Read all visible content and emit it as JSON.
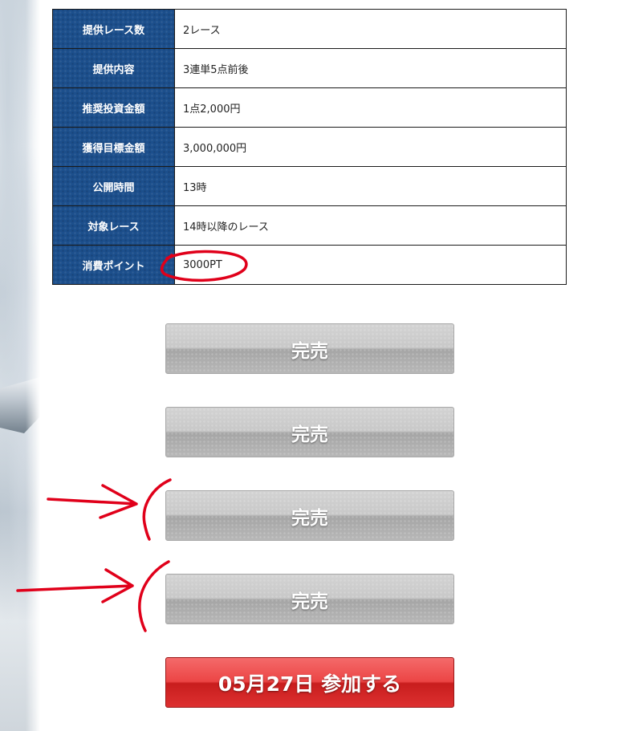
{
  "table": {
    "rows": [
      {
        "label": "提供レース数",
        "value": "2レース"
      },
      {
        "label": "提供内容",
        "value": "3連単5点前後"
      },
      {
        "label": "推奨投資金額",
        "value": "1点2,000円"
      },
      {
        "label": "獲得目標金額",
        "value": "3,000,000円"
      },
      {
        "label": "公開時間",
        "value": "13時"
      },
      {
        "label": "対象レース",
        "value": "14時以降のレース"
      },
      {
        "label": "消費ポイント",
        "value": "3000PT"
      }
    ]
  },
  "buttons": {
    "soldout_1": "完売",
    "soldout_2": "完売",
    "soldout_3": "完売",
    "soldout_4": "完売",
    "join": "05月27日 参加する"
  },
  "colors": {
    "label_bg": "#1c4f8c",
    "soldout": "#c4c4c4",
    "join": "#e23434",
    "annotation": "#e0001a"
  }
}
